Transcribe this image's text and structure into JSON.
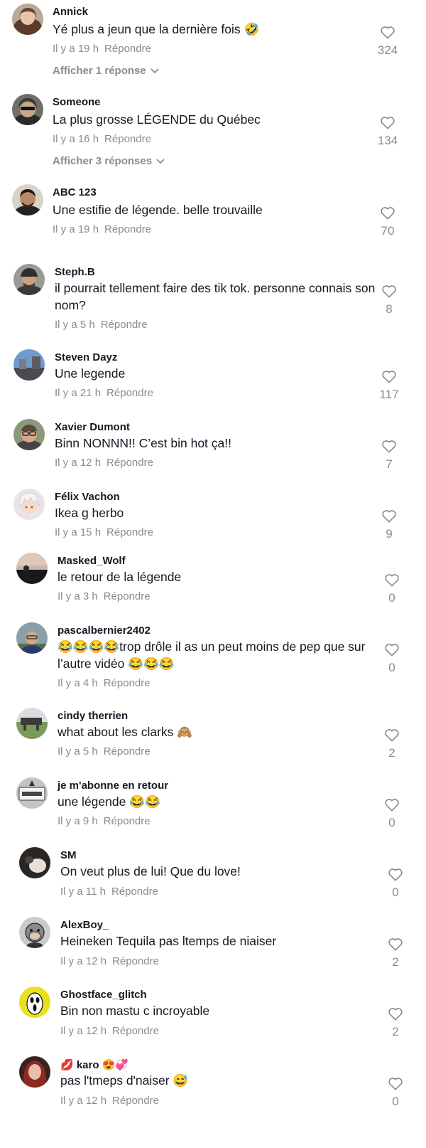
{
  "comments": [
    {
      "user": "Annick",
      "text": "Yé plus a jeun que la dernière fois 🤣",
      "time": "Il y a 19 h",
      "reply": "Répondre",
      "likes": "324",
      "more": "Afficher 1 réponse",
      "avatar": "avatar-woman-brown-hair"
    },
    {
      "user": "Someone",
      "text": "La plus grosse LÉGENDE du Québec",
      "time": "Il y a 16 h",
      "reply": "Répondre",
      "likes": "134",
      "more": "Afficher 3 réponses",
      "avatar": "avatar-man-sunglasses"
    },
    {
      "user": "ABC 123",
      "text": "Une estifie de légende. belle trouvaille",
      "time": "Il y a 19 h",
      "reply": "Répondre",
      "likes": "70",
      "avatar": "avatar-man-beard"
    },
    {
      "user": "Steph.B",
      "text": "il pourrait tellement faire des tik tok. personne connais son nom?",
      "time": "Il y a 5 h",
      "reply": "Répondre",
      "likes": "8",
      "avatar": "avatar-man-cap"
    },
    {
      "user": "Steven Dayz",
      "text": "Une legende",
      "time": "Il y a 21 h",
      "reply": "Répondre",
      "likes": "117",
      "avatar": "avatar-sky"
    },
    {
      "user": "Xavier Dumont",
      "text": "Binn NONNN!! C’est bin hot ça!!",
      "time": "Il y a 12 h",
      "reply": "Répondre",
      "likes": "7",
      "avatar": "avatar-man-glasses"
    },
    {
      "user": "Félix Vachon",
      "text": "Ikea g herbo",
      "time": "Il y a 15 h",
      "reply": "Répondre",
      "likes": "9",
      "avatar": "avatar-anime-white-hair"
    },
    {
      "user": "Masked_Wolf",
      "text": "le retour de la légende",
      "time": "Il y a 3 h",
      "reply": "Répondre",
      "likes": "0",
      "avatar": "avatar-sunset"
    },
    {
      "user": "pascalbernier2402",
      "text": "😂😂😂😂trop drôle il as un peut moins de pep que sur l’autre vidéo 😂😂😂",
      "time": "Il y a 4 h",
      "reply": "Répondre",
      "likes": "0",
      "avatar": "avatar-man-outdoor"
    },
    {
      "user": "cindy therrien",
      "text": "what about les clarks 🙈",
      "time": "Il y a 5 h",
      "reply": "Répondre",
      "likes": "2",
      "avatar": "avatar-landscape"
    },
    {
      "user": "je m'abonne en retour",
      "text": "une légende 😂😂",
      "time": "Il y a 9 h",
      "reply": "Répondre",
      "likes": "0",
      "avatar": "avatar-sign"
    },
    {
      "user": "SM",
      "text": "On veut plus de lui! Que du love!",
      "time": "Il y a 11 h",
      "reply": "Répondre",
      "likes": "0",
      "avatar": "avatar-dark-cat"
    },
    {
      "user": "AlexBoy_",
      "text": "Heineken Tequila pas ltemps de niaiser",
      "time": "Il y a 12 h",
      "reply": "Répondre",
      "likes": "2",
      "avatar": "avatar-ape-cartoon"
    },
    {
      "user": "Ghostface_glitch",
      "text": "Bin non mastu c incroyable",
      "time": "Il y a 12 h",
      "reply": "Répondre",
      "likes": "2",
      "avatar": "avatar-ghostface-mask"
    },
    {
      "user": "💋 karo 😍💞",
      "text": "pas l'tmeps d'naiser 😅",
      "time": "Il y a 12 h",
      "reply": "Répondre",
      "likes": "0",
      "avatar": "avatar-woman-red-hair"
    }
  ],
  "colors": {
    "text": "#161823",
    "muted": "#8a8b91",
    "background": "#ffffff"
  }
}
